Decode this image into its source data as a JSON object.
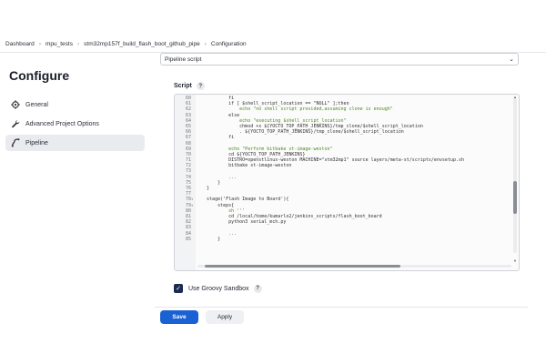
{
  "breadcrumb": [
    "Dashboard",
    "mpu_tests",
    "stm32mp157f_build_flash_boot_github_pipe",
    "Configuration"
  ],
  "sidebar": {
    "title": "Configure",
    "items": [
      {
        "label": "General",
        "icon": "gear-icon"
      },
      {
        "label": "Advanced Project Options",
        "icon": "wrench-icon"
      },
      {
        "label": "Pipeline",
        "icon": "pipeline-icon",
        "active": true
      }
    ]
  },
  "definition_select": {
    "value": "Pipeline script"
  },
  "script": {
    "label": "Script",
    "help": "?",
    "lines": [
      {
        "n": "60",
        "fold": "",
        "code": "            fi"
      },
      {
        "n": "61",
        "fold": "",
        "code": "            if [ $shell_script_location == \"NULL\" ];then"
      },
      {
        "n": "62",
        "fold": "",
        "code": "                echo \"no shell script provided,assuming clone is enough\""
      },
      {
        "n": "63",
        "fold": "",
        "code": "            else"
      },
      {
        "n": "64",
        "fold": "",
        "code": "                echo \"executing $shell_script_location\""
      },
      {
        "n": "65",
        "fold": "",
        "code": "                chmod +x ${YOCTO_TOP_PATH_JENKINS}/tmp_clone/$shell_script_location"
      },
      {
        "n": "66",
        "fold": "",
        "code": "                . ${YOCTO_TOP_PATH_JENKINS}/tmp_clone/$shell_script_location"
      },
      {
        "n": "67",
        "fold": "",
        "code": "            fi"
      },
      {
        "n": "68",
        "fold": "",
        "code": ""
      },
      {
        "n": "69",
        "fold": "",
        "code": "            echo \"Perform bitbake st-image-weston\""
      },
      {
        "n": "70",
        "fold": "",
        "code": "            cd ${YOCTO_TOP_PATH_JENKINS}"
      },
      {
        "n": "71",
        "fold": "",
        "code": "            DISTRO=openstlinux-weston MACHINE=\"stm32mp1\" source layers/meta-st/scripts/envsetup.sh"
      },
      {
        "n": "72",
        "fold": "",
        "code": "            bitbake st-image-weston"
      },
      {
        "n": "73",
        "fold": "",
        "code": ""
      },
      {
        "n": "74",
        "fold": "",
        "code": "            ..."
      },
      {
        "n": "75",
        "fold": "",
        "code": "        }"
      },
      {
        "n": "76",
        "fold": "",
        "code": "    }"
      },
      {
        "n": "77",
        "fold": "",
        "code": ""
      },
      {
        "n": "78",
        "fold": "▾",
        "code": "    stage('Flash Image to Board'){"
      },
      {
        "n": "79",
        "fold": "▾",
        "code": "        steps{"
      },
      {
        "n": "80",
        "fold": "",
        "code": "            sh '''"
      },
      {
        "n": "81",
        "fold": "",
        "code": "            cd /local/home/kumarlo2/jenkins_scripts/flash_boot_board"
      },
      {
        "n": "82",
        "fold": "",
        "code": "            python3 serial_mch.py"
      },
      {
        "n": "83",
        "fold": "",
        "code": ""
      },
      {
        "n": "84",
        "fold": "",
        "code": "            ..."
      },
      {
        "n": "85",
        "fold": "",
        "code": "        }"
      }
    ]
  },
  "sandbox": {
    "label": "Use Groovy Sandbox",
    "checked": true,
    "help": "?"
  },
  "buttons": {
    "save": "Save",
    "apply": "Apply"
  },
  "colors": {
    "primary": "#1a62d4",
    "code_string": "#4b8a1f",
    "checkbox": "#1b2b52"
  }
}
